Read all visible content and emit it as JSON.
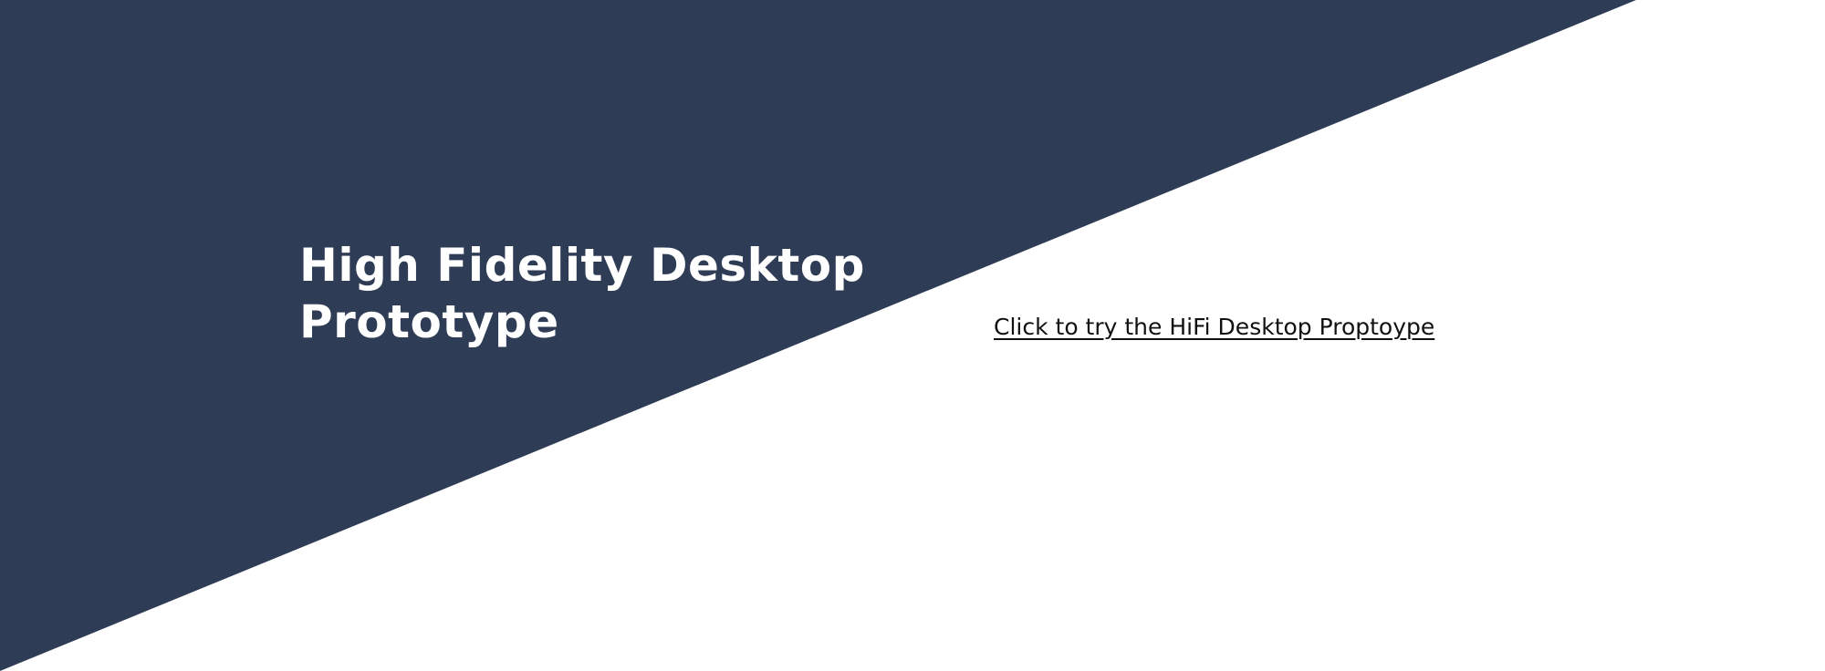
{
  "hero": {
    "title": "High Fidelity Desktop Prototype"
  },
  "cta": {
    "link_text": "Click to try the HiFi Desktop Proptoype"
  },
  "colors": {
    "background": "#ffffff",
    "diagonal_panel": "#2f3c56",
    "title_text": "#ffffff",
    "link_text": "#111111"
  }
}
